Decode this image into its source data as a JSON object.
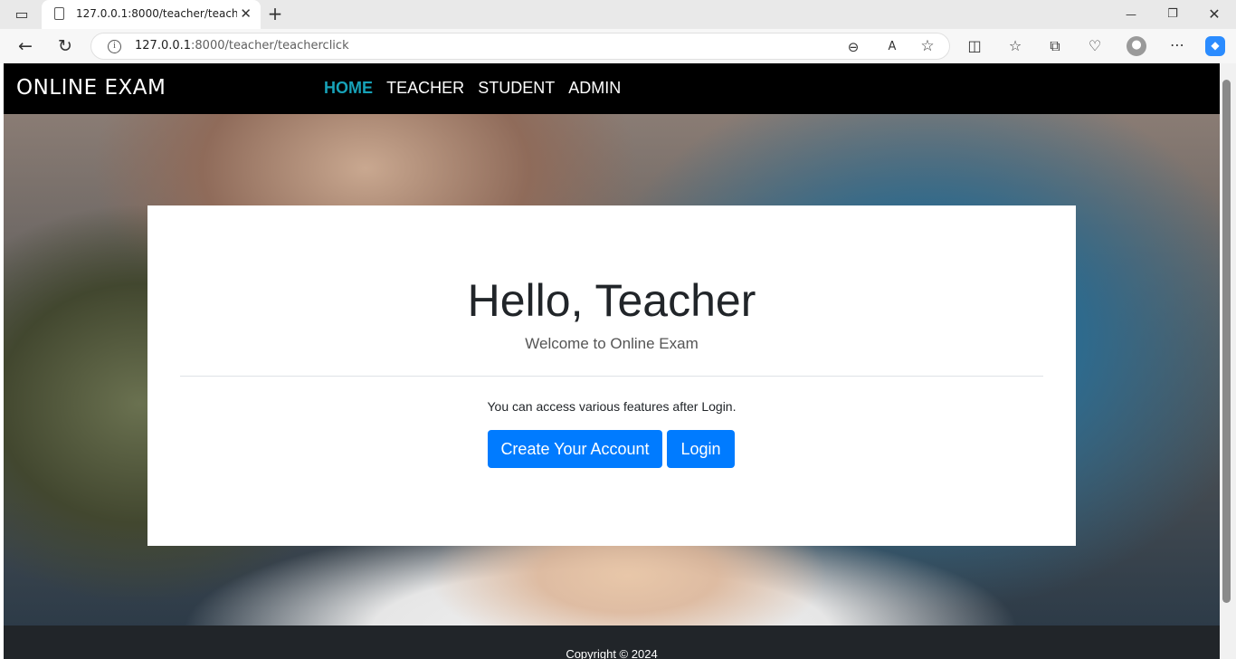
{
  "browser": {
    "tab_title": "127.0.0.1:8000/teacher/teacherclick",
    "tab_close": "✕",
    "new_tab": "+",
    "url_host": "127.0.0.1",
    "url_path": ":8000/teacher/teacherclick",
    "window_controls": [
      "—",
      "❐",
      "✕"
    ]
  },
  "navbar": {
    "brand": "ONLINE EXAM",
    "links": [
      "HOME",
      "TEACHER",
      "STUDENT",
      "ADMIN"
    ]
  },
  "card": {
    "heading": "Hello, Teacher",
    "subheading": "Welcome to Online Exam",
    "note": "You can access various features after Login.",
    "create_button": "Create Your Account",
    "login_button": "Login"
  },
  "footer": {
    "copyright": "Copyright © 2024"
  },
  "colors": {
    "navbar_bg": "#000000",
    "active_link": "#17a2b8",
    "primary_button": "#007bff",
    "footer_bg": "#212529"
  }
}
